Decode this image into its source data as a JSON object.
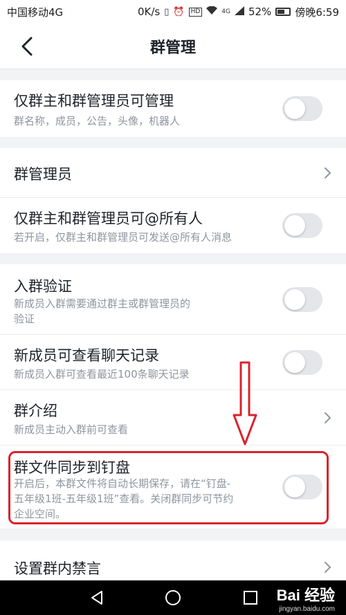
{
  "status_bar": {
    "carrier": "中国移动4G",
    "speed": "0K/s",
    "network_badge": "HD",
    "signal_badge": "4G",
    "battery": "52%",
    "time": "傍晚6:59",
    "icons": [
      "vibrate-icon",
      "alarm-icon",
      "wifi-icon",
      "signal-icon",
      "battery-icon"
    ]
  },
  "nav": {
    "title": "群管理",
    "back_icon": "chevron-left-icon"
  },
  "settings": [
    {
      "title": "仅群主和群管理员可管理",
      "subtitle": "群名称，成员，公告，头像，机器人",
      "control": "toggle",
      "on": false
    },
    {
      "title": "群管理员",
      "control": "chevron"
    },
    {
      "title": "仅群主和群管理员可@所有人",
      "subtitle": "若开启，仅群主和群管理员可发送@所有人消息",
      "control": "toggle",
      "on": false
    },
    {
      "title": "入群验证",
      "subtitle_lines": [
        "新成员入群需要通过群主或群管理员的",
        "验证"
      ],
      "control": "toggle",
      "on": false
    },
    {
      "title": "新成员可查看聊天记录",
      "subtitle": "新成员入群可查看最近100条聊天记录",
      "control": "toggle",
      "on": false
    },
    {
      "title": "群介绍",
      "subtitle": "新成员主动入群前可查看",
      "control": "chevron"
    },
    {
      "title": "群文件同步到钉盘",
      "subtitle_lines": [
        "开启后，本群文件将自动长期保存，请在“钉盘-",
        "五年级1班-五年级1班”查看。关闭群同步可节约",
        "企业空间。"
      ],
      "control": "toggle",
      "on": false
    },
    {
      "title": "设置群内禁言",
      "control": "chevron"
    }
  ],
  "colors": {
    "highlight": "#d9232d",
    "toggle_off": "#e4e6ea",
    "subtitle": "#8f959e"
  },
  "watermark": {
    "main": "Bai 经验",
    "sub": "jingyan.baidu.com"
  }
}
